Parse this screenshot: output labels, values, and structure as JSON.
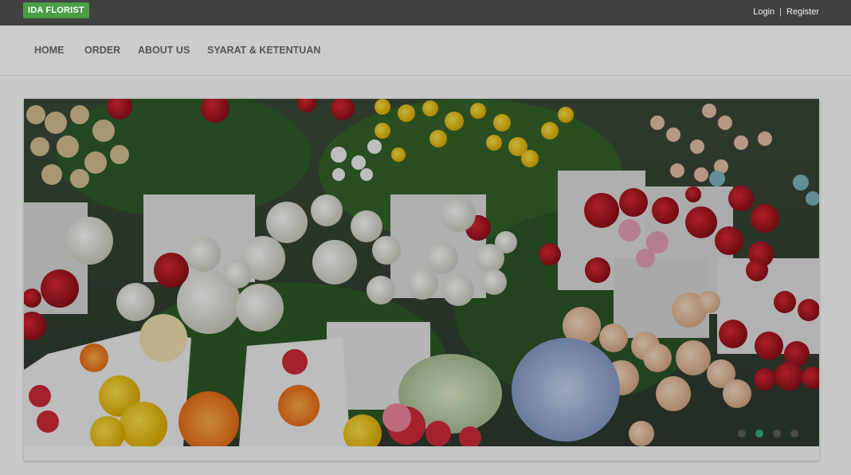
{
  "topbar": {
    "brand": "IDA FLORIST",
    "login": "Login",
    "separator": "|",
    "register": "Register"
  },
  "nav": {
    "items": [
      {
        "label": "HOME"
      },
      {
        "label": "ORDER"
      },
      {
        "label": "ABOUT US"
      },
      {
        "label": "SYARAT & KETENTUAN"
      }
    ]
  },
  "slider": {
    "slide_image": "flower-market-photo",
    "slide_count": 4,
    "active_slide": 2
  },
  "colors": {
    "topbar": "#414141",
    "brand": "#4a9c45",
    "navbar": "#cccccc",
    "page": "#c8c8c8",
    "active_dot": "#2a8a63"
  }
}
